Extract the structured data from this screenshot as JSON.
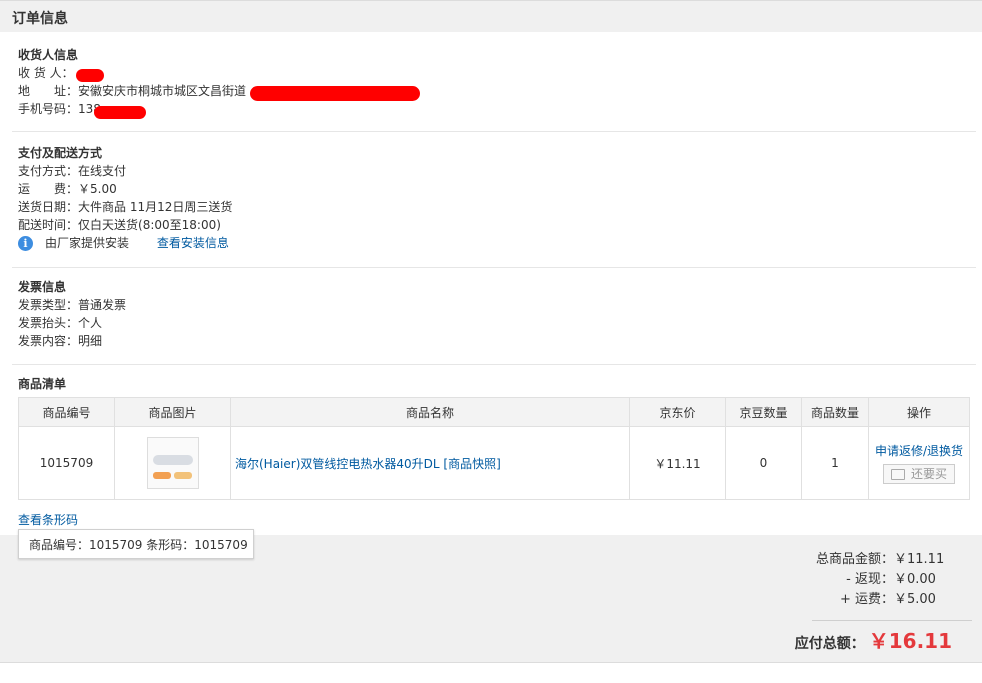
{
  "header": {
    "title": "订单信息"
  },
  "receiver": {
    "title": "收货人信息",
    "name_label": "收 货 人：",
    "address_label": "地　　址：",
    "address_value": "安徽安庆市桐城市城区文昌街道",
    "phone_label": "手机号码：",
    "phone_value": "138"
  },
  "payment": {
    "title": "支付及配送方式",
    "method_label": "支付方式：",
    "method_value": "在线支付",
    "freight_label": "运　　费：",
    "freight_value": "￥5.00",
    "date_label": "送货日期：",
    "date_value": "大件商品  11月12日周三送货",
    "time_label": "配送时间：",
    "time_value": "仅白天送货(8:00至18:00)",
    "install_text": "由厂家提供安装",
    "install_link": "查看安装信息"
  },
  "invoice": {
    "title": "发票信息",
    "type_label": "发票类型：",
    "type_value": "普通发票",
    "head_label": "发票抬头：",
    "head_value": "个人",
    "content_label": "发票内容：",
    "content_value": "明细"
  },
  "goods": {
    "title": "商品清单",
    "columns": [
      "商品编号",
      "商品图片",
      "商品名称",
      "京东价",
      "京豆数量",
      "商品数量",
      "操作"
    ],
    "items": [
      {
        "sku": "1015709",
        "name": "海尔(Haier)双管线控电热水器40升DL [商品快照]",
        "price": "￥11.11",
        "beans": "0",
        "qty": "1",
        "action_link": "申请返修/退换货",
        "rebuy_label": "还要买"
      }
    ],
    "barcode_link": "查看条形码",
    "barcode_tip": "商品编号：1015709   条形码：1015709"
  },
  "totals": {
    "goods_label": "总商品金额：",
    "goods_value": "￥11.11",
    "cashback_label": "- 返现：",
    "cashback_value": "￥0.00",
    "freight_label": "+ 运费：",
    "freight_value": "￥5.00",
    "pay_label": "应付总额：",
    "pay_value": "￥16.11"
  },
  "colors": {
    "accent_red": "#e4393c",
    "link_blue": "#005aa0",
    "redaction": "#ff0000"
  }
}
